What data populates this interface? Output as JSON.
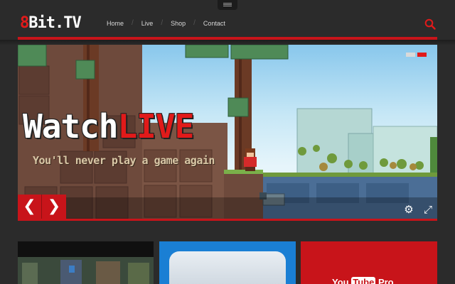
{
  "header": {
    "logo_prefix": "8",
    "logo_rest": "Bit.TV",
    "nav": [
      {
        "label": "Home"
      },
      {
        "label": "Live"
      },
      {
        "label": "Shop"
      },
      {
        "label": "Contact"
      }
    ],
    "nav_separator": "/",
    "search_icon": "search-icon"
  },
  "hero": {
    "title_white": "Watch",
    "title_red": "LIVE",
    "subtitle": "You'll never play a game again",
    "prev_icon": "chevron-left-icon",
    "next_icon": "chevron-right-icon",
    "prev_glyph": "❮",
    "next_glyph": "❯",
    "settings_glyph": "⚙",
    "fullscreen_glyph": "⤢",
    "slides": [
      {
        "active": false
      },
      {
        "active": true
      }
    ]
  },
  "cards": {
    "youtube_prefix": "You",
    "youtube_tube": "Tube",
    "youtube_suffix": "Pro"
  },
  "colors": {
    "accent": "#e11a1a",
    "bar_red": "#c8141a",
    "background": "#2b2b2b"
  }
}
